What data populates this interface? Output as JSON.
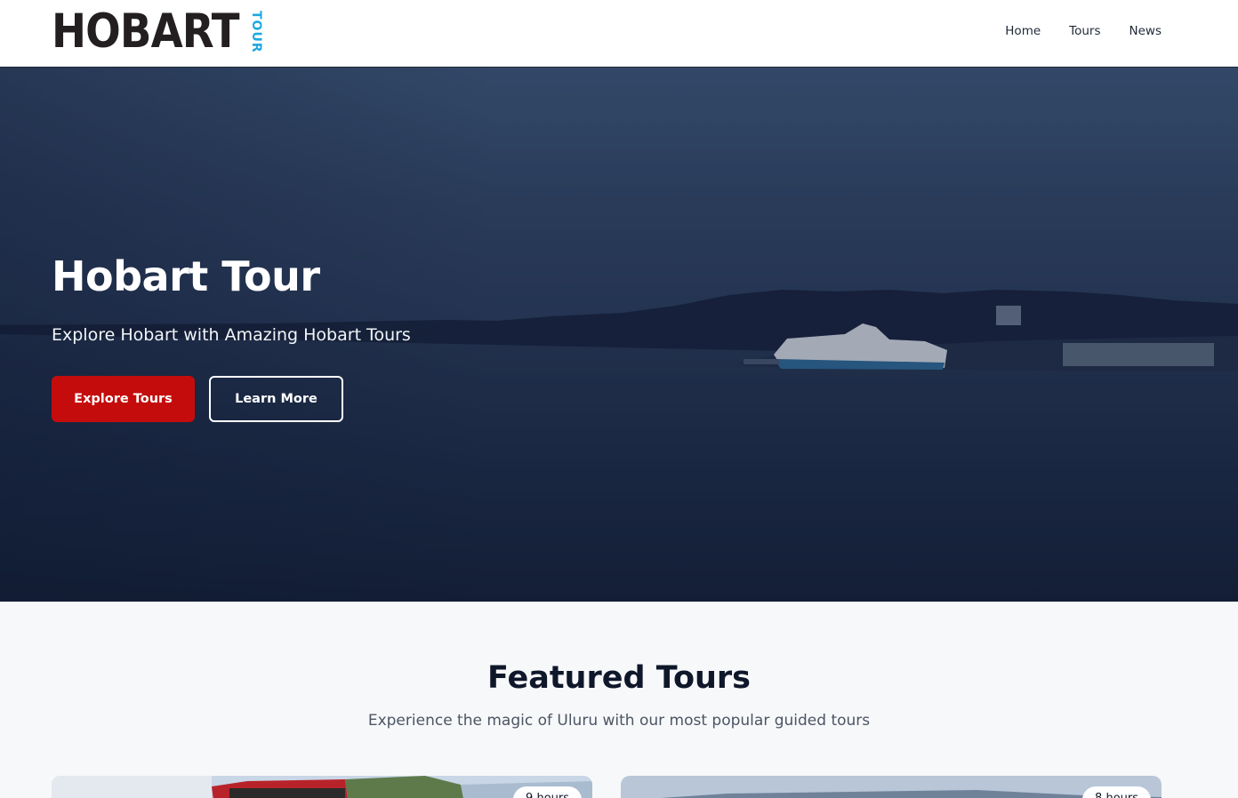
{
  "header": {
    "logo_main": "HOBART",
    "logo_side": "TOUR",
    "nav": [
      {
        "label": "Home"
      },
      {
        "label": "Tours"
      },
      {
        "label": "News"
      }
    ]
  },
  "hero": {
    "title": "Hobart Tour",
    "subtitle": "Explore Hobart with Amazing Hobart Tours",
    "primary_button": "Explore Tours",
    "secondary_button": "Learn More"
  },
  "featured": {
    "title": "Featured Tours",
    "subtitle": "Experience the magic of Uluru with our most popular guided tours",
    "cards": [
      {
        "badge": "9 hours"
      },
      {
        "badge": "8 hours"
      }
    ]
  },
  "colors": {
    "primary_red": "#c40c0c",
    "logo_blue": "#1ea7e1",
    "logo_dark": "#231f20",
    "hero_dark": "#1e2c48"
  }
}
